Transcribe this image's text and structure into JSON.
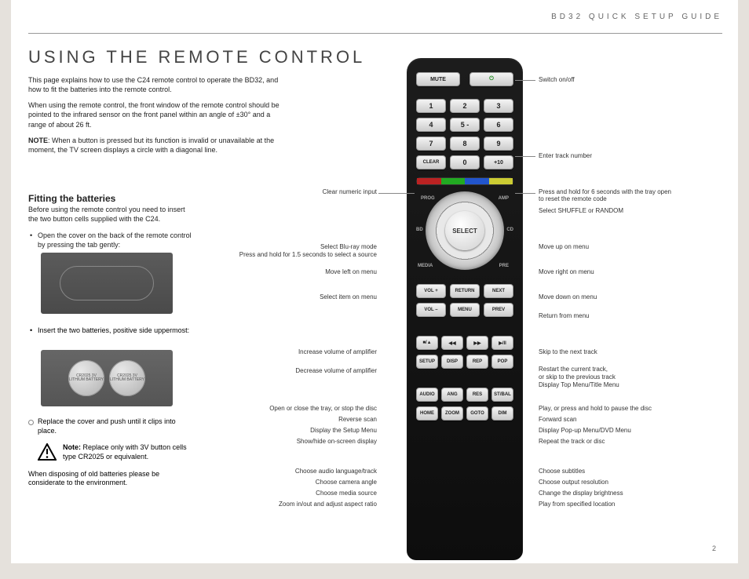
{
  "header": "BD32   QUICK   SETUP   GUIDE",
  "title": "USING THE REMOTE CONTROL",
  "intro": {
    "p1": "This page explains how to use the C24 remote control to operate the BD32, and how to fit the batteries into the remote control.",
    "p2": "When using the remote control, the front window of the remote control should be pointed to the infrared sensor on the front panel within an angle of ±30° and a range of about 26 ft.",
    "note_label": "NOTE",
    "p3": ": When a button is pressed but its function is invalid or unavailable at the moment, the TV screen displays a circle with a diagonal line."
  },
  "fitting": {
    "head": "Fitting the batteries",
    "lead": "Before using the remote control you need to insert the two button cells supplied with the C24.",
    "b1": "Open the cover on the back of the remote control by pressing the tab gently:",
    "b2": "Insert the two batteries, positive side uppermost:",
    "b3": "Replace the cover and push until it clips into place.",
    "cell_text": "CR2025\n3V\nLITHIUM BATTERY",
    "note_bold": "Note:",
    "note": " Replace only with 3V button cells type CR2025 or equivalent.",
    "dispose": "When disposing of old batteries please be considerate to the environment."
  },
  "remote": {
    "mute": "MUTE",
    "power": "⏻",
    "nums": [
      "1",
      "2",
      "3",
      "4",
      "5 -",
      "6",
      "7",
      "8",
      "9"
    ],
    "clear": "CLEAR",
    "zero": "0",
    "plus10": "+10",
    "prog": "PROG",
    "amp": "AMP",
    "bd": "BD",
    "cd": "CD",
    "media": "MEDIA",
    "pre": "PRE",
    "select": "SELECT",
    "volp": "VOL +",
    "volm": "VOL –",
    "ret": "RETURN",
    "menu": "MENU",
    "next": "NEXT",
    "prev": "PREV",
    "stop": "■/▲",
    "rev": "◀◀",
    "fwd": "▶▶",
    "play": "▶/II",
    "setup": "SETUP",
    "disp": "DISP",
    "rep": "REP",
    "pop": "POP",
    "audio": "AUDIO",
    "ang": "ANG",
    "res": "RES",
    "stbal": "ST/BAL",
    "home": "HOME",
    "zoom": "ZOOM",
    "goto": "GOTO",
    "dim": "DIM"
  },
  "labels": {
    "left": {
      "clear_num": "Clear numeric input",
      "sel_blu1": "Select Blu-ray mode",
      "sel_blu2": "Press and hold for 1.5 seconds to select a source",
      "move_left": "Move left on menu",
      "sel_item": "Select item on menu",
      "inc_vol": "Increase volume of amplifier",
      "dec_vol": "Decrease volume of amplifier",
      "open_tray": "Open or close the tray, or stop the disc",
      "rev_scan": "Reverse scan",
      "setup_menu": "Display the Setup Menu",
      "show_hide": "Show/hide on-screen display",
      "choose_audio": "Choose audio language/track",
      "choose_angle": "Choose camera angle",
      "choose_media": "Choose media source",
      "zoom": "Zoom in/out and adjust aspect ratio"
    },
    "right": {
      "switch": "Switch on/off",
      "enter_track": "Enter track number",
      "press_hold": "Press and hold for 6 seconds with the tray open to reset the remote code",
      "shuffle": "Select SHUFFLE or RANDOM",
      "move_up": "Move up on menu",
      "move_right": "Move right on menu",
      "move_down": "Move down on menu",
      "return_menu": "Return from menu",
      "skip_next": "Skip to the next track",
      "restart1": "Restart the current track,",
      "restart2": "or skip to the previous track",
      "disp_top": "Display Top Menu/Title Menu",
      "play_pause": "Play, or press and hold to pause the disc",
      "fwd_scan": "Forward scan",
      "popup": "Display Pop-up Menu/DVD Menu",
      "repeat": "Repeat the track or disc",
      "subtitles": "Choose subtitles",
      "output_res": "Choose output resolution",
      "brightness": "Change the display brightness",
      "play_from": "Play from specified location"
    }
  },
  "page_num": "2"
}
